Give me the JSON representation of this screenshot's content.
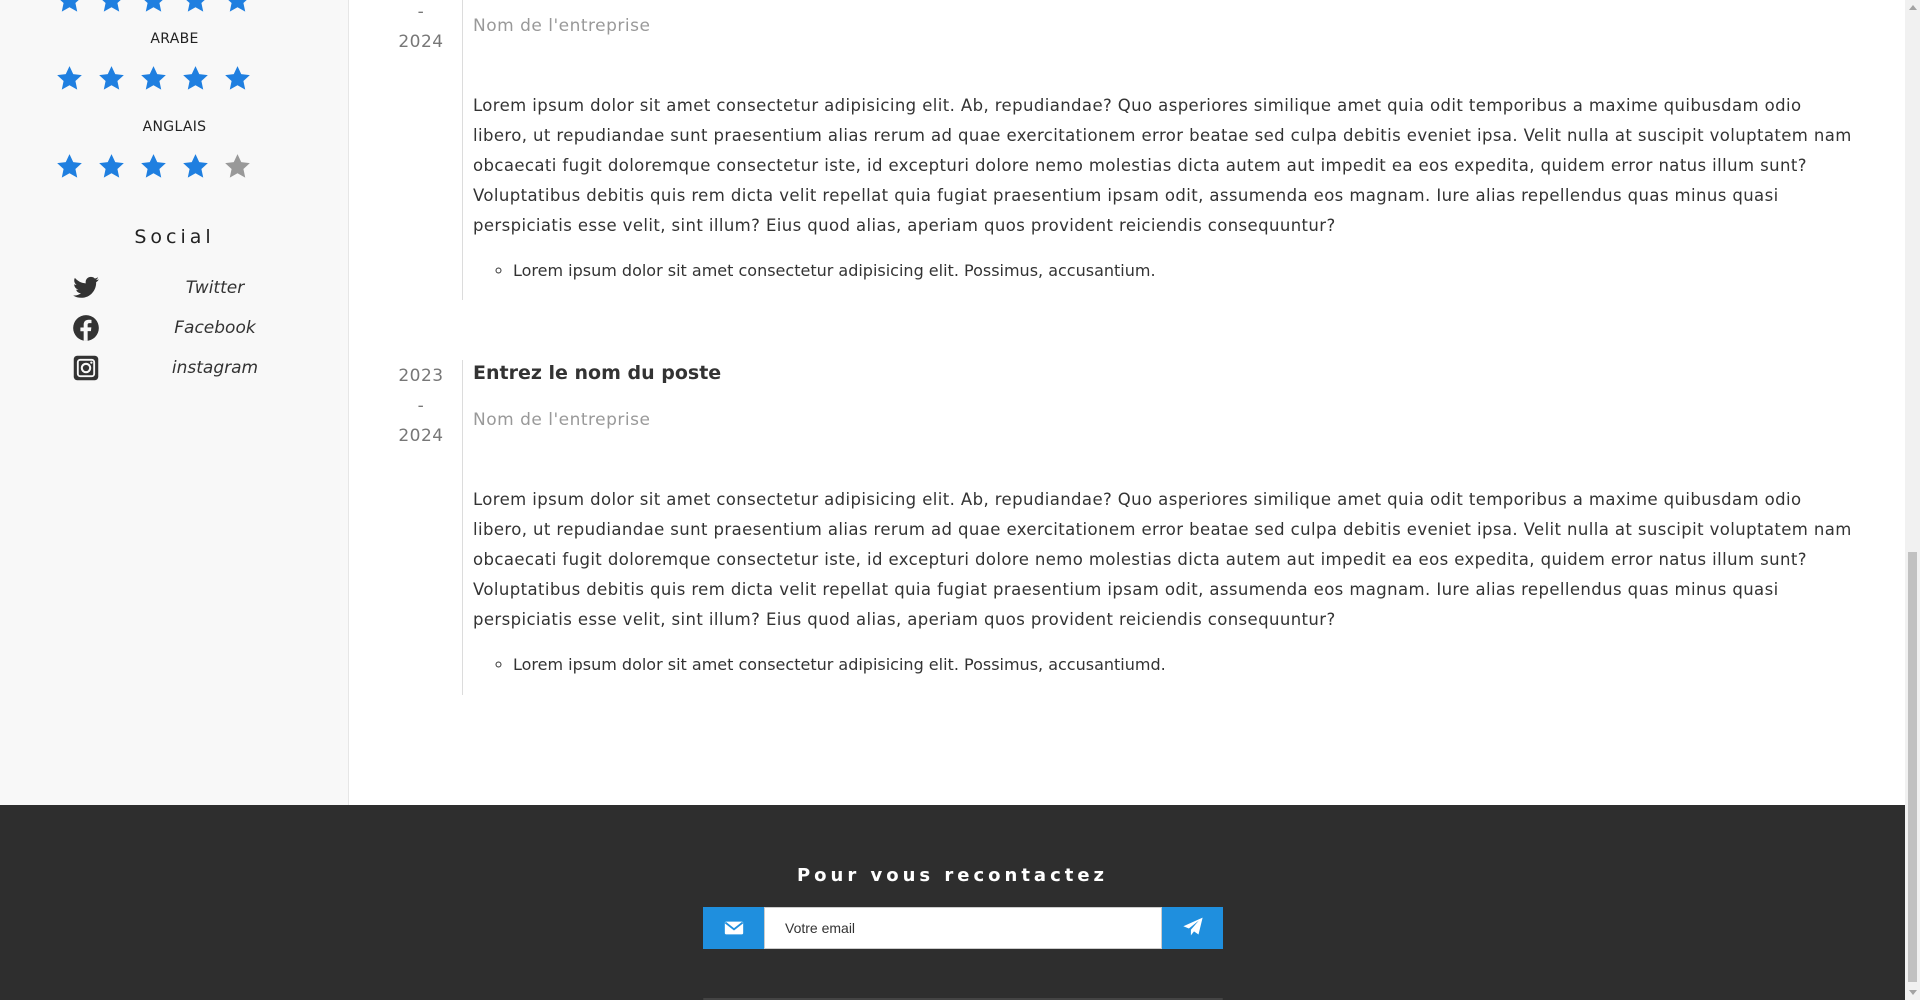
{
  "sidebar": {
    "top_star_count": 5,
    "languages": [
      {
        "label": "ARABE",
        "rating": 5,
        "max": 5
      },
      {
        "label": "ANGLAIS",
        "rating": 4,
        "max": 5
      }
    ],
    "social_title": "Social",
    "social": [
      {
        "label": "Twitter",
        "icon": "twitter-icon"
      },
      {
        "label": "Facebook",
        "icon": "facebook-icon"
      },
      {
        "label": "instagram",
        "icon": "instagram-icon"
      }
    ]
  },
  "experience": [
    {
      "start": "",
      "separator": "-",
      "end": "2024",
      "title": "",
      "company": "Nom de l'entreprise",
      "description": "Lorem ipsum dolor sit amet consectetur adipisicing elit. Ab, repudiandae? Quo asperiores similique amet quia odit temporibus a maxime quibusdam odio libero, ut repudiandae sunt praesentium alias rerum ad quae exercitationem error beatae sed culpa debitis eveniet ipsa. Velit nulla at suscipit voluptatem nam obcaecati fugit doloremque consectetur iste, id excepturi dolore nemo molestias dicta autem aut impedit ea eos expedita, quidem error natus illum sunt? Voluptatibus debitis quis rem dicta velit repellat quia fugiat praesentium ipsam odit, assumenda eos magnam. Iure alias repellendus quas minus quasi perspiciatis esse velit, sint illum? Eius quod alias, aperiam quos provident reiciendis consequuntur?",
      "bullets": [
        "Lorem ipsum dolor sit amet consectetur adipisicing elit. Possimus, accusantium."
      ]
    },
    {
      "start": "2023",
      "separator": "-",
      "end": "2024",
      "title": "Entrez le nom du poste",
      "company": "Nom de l'entreprise",
      "description": "Lorem ipsum dolor sit amet consectetur adipisicing elit. Ab, repudiandae? Quo asperiores similique amet quia odit temporibus a maxime quibusdam odio libero, ut repudiandae sunt praesentium alias rerum ad quae exercitationem error beatae sed culpa debitis eveniet ipsa. Velit nulla at suscipit voluptatem nam obcaecati fugit doloremque consectetur iste, id excepturi dolore nemo molestias dicta autem aut impedit ea eos expedita, quidem error natus illum sunt? Voluptatibus debitis quis rem dicta velit repellat quia fugiat praesentium ipsam odit, assumenda eos magnam. Iure alias repellendus quas minus quasi perspiciatis esse velit, sint illum? Eius quod alias, aperiam quos provident reiciendis consequuntur?",
      "bullets": [
        "Lorem ipsum dolor sit amet consectetur adipisicing elit. Possimus, accusantiumd."
      ]
    }
  ],
  "footer": {
    "title": "Pour vous recontactez",
    "email_placeholder": "Votre email",
    "envelope_icon": "envelope-icon",
    "send_icon": "paper-plane-icon"
  },
  "colors": {
    "star_filled": "#1f7fe0",
    "star_empty": "#999999",
    "accent": "#1f8fde",
    "footer_bg": "#2e2e2e"
  }
}
